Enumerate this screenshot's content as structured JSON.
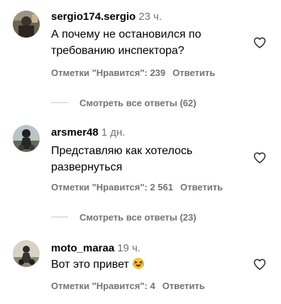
{
  "comments": [
    {
      "username": "sergio174.sergio",
      "time": "23 ч.",
      "text": "А почему не остановился по требованию инспектора?",
      "likes": "Отметки \"Нравится\": 239",
      "reply": "Ответить",
      "view_replies": "Смотреть все ответы (62)"
    },
    {
      "username": "arsmer48",
      "time": "1 дн.",
      "text": "Представляю как хотелось развернуться",
      "likes": "Отметки \"Нравится\": 2 561",
      "reply": "Ответить",
      "view_replies": "Смотреть все ответы (23)"
    },
    {
      "username": "moto_maraa",
      "time": "19 ч.",
      "text": "Вот это привет",
      "emoji": "laughing-emoji",
      "likes": "Отметки \"Нравится\": 4",
      "reply": "Ответить"
    }
  ]
}
